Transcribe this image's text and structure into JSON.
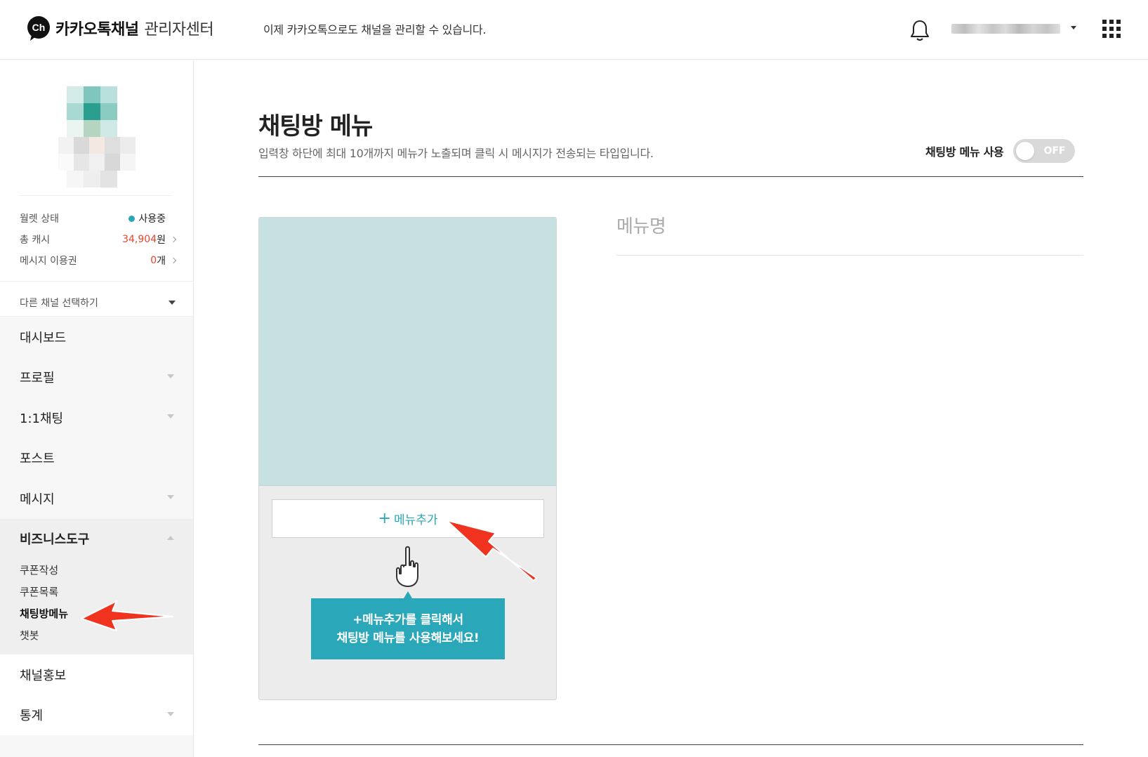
{
  "header": {
    "logo_badge": "Ch",
    "logo_main": "카카오톡채널",
    "logo_sub": "관리자센터",
    "message": "이제 카카오톡으로도 채널을 관리할 수 있습니다."
  },
  "wallet": {
    "status_label": "월렛 상태",
    "status_value": "사용중",
    "cash_label": "총 캐시",
    "cash_value": "34,904",
    "cash_unit": "원",
    "ticket_label": "메시지 이용권",
    "ticket_value": "0",
    "ticket_unit": "개"
  },
  "channel_select": "다른 채널 선택하기",
  "nav": {
    "items": [
      {
        "label": "대시보드"
      },
      {
        "label": "프로필"
      },
      {
        "label": "1:1채팅"
      },
      {
        "label": "포스트"
      },
      {
        "label": "메시지"
      }
    ],
    "group": {
      "label": "비즈니스도구",
      "sub_items": [
        "쿠폰작성",
        "쿠폰목록",
        "채팅방메뉴",
        "챗봇"
      ]
    },
    "items_after": [
      {
        "label": "채널홍보"
      },
      {
        "label": "통계"
      }
    ]
  },
  "main": {
    "title": "채팅방 메뉴",
    "description": "입력창 하단에 최대 10개까지 메뉴가 노출되며 클릭 시 메시지가 전송되는 타입입니다.",
    "toggle_label": "채팅방 메뉴 사용",
    "toggle_state": "OFF",
    "add_menu_plus": "+",
    "add_menu_label": "메뉴추가",
    "tooltip_line1": "+메뉴추가를 클릭해서",
    "tooltip_line2": "채팅방 메뉴를 사용해보세요!",
    "menu_name_placeholder": "메뉴명"
  },
  "colors": {
    "accent": "#2aa7b8",
    "annotation_arrow": "#f0331f",
    "cash_red": "#e8442b"
  }
}
